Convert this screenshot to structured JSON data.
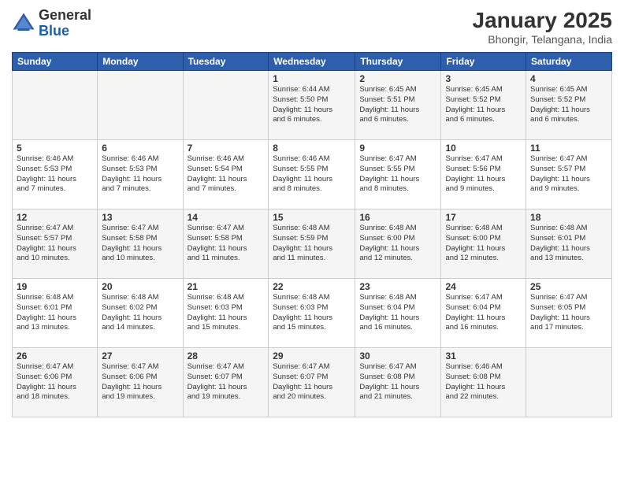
{
  "header": {
    "logo_line1": "General",
    "logo_line2": "Blue",
    "month": "January 2025",
    "location": "Bhongir, Telangana, India"
  },
  "weekdays": [
    "Sunday",
    "Monday",
    "Tuesday",
    "Wednesday",
    "Thursday",
    "Friday",
    "Saturday"
  ],
  "weeks": [
    [
      {
        "day": "",
        "info": ""
      },
      {
        "day": "",
        "info": ""
      },
      {
        "day": "",
        "info": ""
      },
      {
        "day": "1",
        "info": "Sunrise: 6:44 AM\nSunset: 5:50 PM\nDaylight: 11 hours\nand 6 minutes."
      },
      {
        "day": "2",
        "info": "Sunrise: 6:45 AM\nSunset: 5:51 PM\nDaylight: 11 hours\nand 6 minutes."
      },
      {
        "day": "3",
        "info": "Sunrise: 6:45 AM\nSunset: 5:52 PM\nDaylight: 11 hours\nand 6 minutes."
      },
      {
        "day": "4",
        "info": "Sunrise: 6:45 AM\nSunset: 5:52 PM\nDaylight: 11 hours\nand 6 minutes."
      }
    ],
    [
      {
        "day": "5",
        "info": "Sunrise: 6:46 AM\nSunset: 5:53 PM\nDaylight: 11 hours\nand 7 minutes."
      },
      {
        "day": "6",
        "info": "Sunrise: 6:46 AM\nSunset: 5:53 PM\nDaylight: 11 hours\nand 7 minutes."
      },
      {
        "day": "7",
        "info": "Sunrise: 6:46 AM\nSunset: 5:54 PM\nDaylight: 11 hours\nand 7 minutes."
      },
      {
        "day": "8",
        "info": "Sunrise: 6:46 AM\nSunset: 5:55 PM\nDaylight: 11 hours\nand 8 minutes."
      },
      {
        "day": "9",
        "info": "Sunrise: 6:47 AM\nSunset: 5:55 PM\nDaylight: 11 hours\nand 8 minutes."
      },
      {
        "day": "10",
        "info": "Sunrise: 6:47 AM\nSunset: 5:56 PM\nDaylight: 11 hours\nand 9 minutes."
      },
      {
        "day": "11",
        "info": "Sunrise: 6:47 AM\nSunset: 5:57 PM\nDaylight: 11 hours\nand 9 minutes."
      }
    ],
    [
      {
        "day": "12",
        "info": "Sunrise: 6:47 AM\nSunset: 5:57 PM\nDaylight: 11 hours\nand 10 minutes."
      },
      {
        "day": "13",
        "info": "Sunrise: 6:47 AM\nSunset: 5:58 PM\nDaylight: 11 hours\nand 10 minutes."
      },
      {
        "day": "14",
        "info": "Sunrise: 6:47 AM\nSunset: 5:58 PM\nDaylight: 11 hours\nand 11 minutes."
      },
      {
        "day": "15",
        "info": "Sunrise: 6:48 AM\nSunset: 5:59 PM\nDaylight: 11 hours\nand 11 minutes."
      },
      {
        "day": "16",
        "info": "Sunrise: 6:48 AM\nSunset: 6:00 PM\nDaylight: 11 hours\nand 12 minutes."
      },
      {
        "day": "17",
        "info": "Sunrise: 6:48 AM\nSunset: 6:00 PM\nDaylight: 11 hours\nand 12 minutes."
      },
      {
        "day": "18",
        "info": "Sunrise: 6:48 AM\nSunset: 6:01 PM\nDaylight: 11 hours\nand 13 minutes."
      }
    ],
    [
      {
        "day": "19",
        "info": "Sunrise: 6:48 AM\nSunset: 6:01 PM\nDaylight: 11 hours\nand 13 minutes."
      },
      {
        "day": "20",
        "info": "Sunrise: 6:48 AM\nSunset: 6:02 PM\nDaylight: 11 hours\nand 14 minutes."
      },
      {
        "day": "21",
        "info": "Sunrise: 6:48 AM\nSunset: 6:03 PM\nDaylight: 11 hours\nand 15 minutes."
      },
      {
        "day": "22",
        "info": "Sunrise: 6:48 AM\nSunset: 6:03 PM\nDaylight: 11 hours\nand 15 minutes."
      },
      {
        "day": "23",
        "info": "Sunrise: 6:48 AM\nSunset: 6:04 PM\nDaylight: 11 hours\nand 16 minutes."
      },
      {
        "day": "24",
        "info": "Sunrise: 6:47 AM\nSunset: 6:04 PM\nDaylight: 11 hours\nand 16 minutes."
      },
      {
        "day": "25",
        "info": "Sunrise: 6:47 AM\nSunset: 6:05 PM\nDaylight: 11 hours\nand 17 minutes."
      }
    ],
    [
      {
        "day": "26",
        "info": "Sunrise: 6:47 AM\nSunset: 6:06 PM\nDaylight: 11 hours\nand 18 minutes."
      },
      {
        "day": "27",
        "info": "Sunrise: 6:47 AM\nSunset: 6:06 PM\nDaylight: 11 hours\nand 19 minutes."
      },
      {
        "day": "28",
        "info": "Sunrise: 6:47 AM\nSunset: 6:07 PM\nDaylight: 11 hours\nand 19 minutes."
      },
      {
        "day": "29",
        "info": "Sunrise: 6:47 AM\nSunset: 6:07 PM\nDaylight: 11 hours\nand 20 minutes."
      },
      {
        "day": "30",
        "info": "Sunrise: 6:47 AM\nSunset: 6:08 PM\nDaylight: 11 hours\nand 21 minutes."
      },
      {
        "day": "31",
        "info": "Sunrise: 6:46 AM\nSunset: 6:08 PM\nDaylight: 11 hours\nand 22 minutes."
      },
      {
        "day": "",
        "info": ""
      }
    ]
  ]
}
